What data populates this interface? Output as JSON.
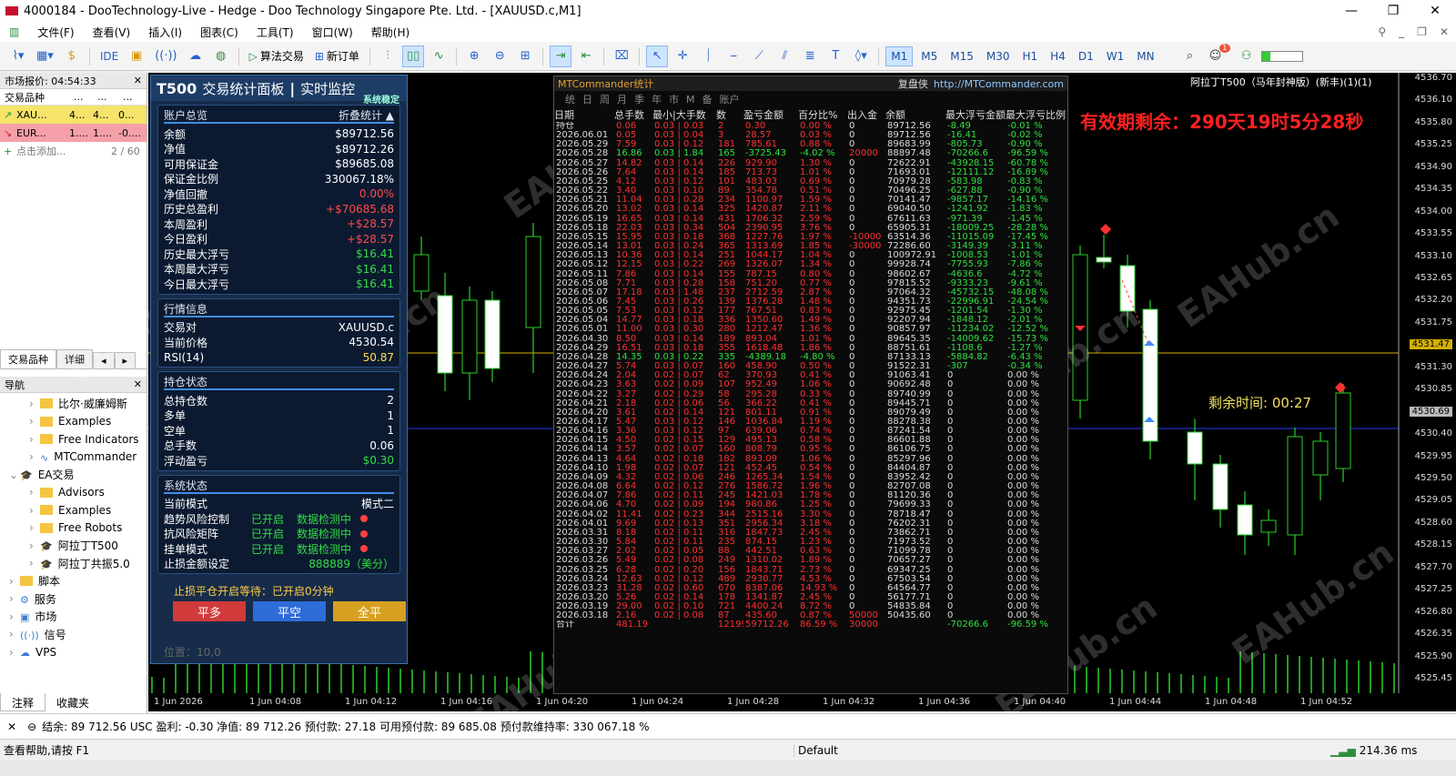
{
  "window": {
    "title": "4000184 - DooTechnology-Live - Hedge - Doo Technology Singapore Pte. Ltd. - [XAUUSD.c,M1]"
  },
  "menu": [
    "文件(F)",
    "查看(V)",
    "插入(I)",
    "图表(C)",
    "工具(T)",
    "窗口(W)",
    "帮助(H)"
  ],
  "toolbar": {
    "ide": "IDE",
    "algo": "算法交易",
    "new_order": "新订单",
    "timeframes": [
      "M1",
      "M5",
      "M15",
      "M30",
      "H1",
      "H4",
      "D1",
      "W1",
      "MN"
    ],
    "active_tf": "M1",
    "notif": "1"
  },
  "market_watch": {
    "title": "市场报价: 04:54:33",
    "col_symbol": "交易品种",
    "col_bid": "...",
    "col_ask": "...",
    "col_chg": "...",
    "rows": [
      {
        "symbol": "XAU...",
        "bid": "4...",
        "ask": "4...",
        "chg": "0...",
        "color": "#f5e36a"
      },
      {
        "symbol": "EUR...",
        "bid": "1....",
        "ask": "1....",
        "chg": "-0....",
        "color": "#f5a0a8"
      }
    ],
    "add": "点击添加...",
    "count": "2 / 60",
    "tab_symbols": "交易品种",
    "tab_details": "详细"
  },
  "navigator": {
    "title": "导航",
    "items": [
      {
        "label": "比尔·威廉姆斯",
        "indent": 2,
        "icon": "folder"
      },
      {
        "label": "Examples",
        "indent": 2,
        "icon": "folder"
      },
      {
        "label": "Free Indicators",
        "indent": 2,
        "icon": "folder"
      },
      {
        "label": "MTCommander",
        "indent": 2,
        "icon": "indicator"
      },
      {
        "label": "EA交易",
        "indent": 1,
        "icon": "ea"
      },
      {
        "label": "Advisors",
        "indent": 2,
        "icon": "folder"
      },
      {
        "label": "Examples",
        "indent": 2,
        "icon": "folder"
      },
      {
        "label": "Free Robots",
        "indent": 2,
        "icon": "folder"
      },
      {
        "label": "阿拉丁T500",
        "indent": 2,
        "icon": "ea"
      },
      {
        "label": "阿拉丁共振5.0",
        "indent": 2,
        "icon": "ea"
      },
      {
        "label": "脚本",
        "indent": 1,
        "icon": "folder"
      },
      {
        "label": "服务",
        "indent": 1,
        "icon": "gear"
      },
      {
        "label": "市场",
        "indent": 1,
        "icon": "bag"
      },
      {
        "label": "信号",
        "indent": 1,
        "icon": "signal"
      },
      {
        "label": "VPS",
        "indent": 1,
        "icon": "cloud"
      }
    ],
    "tab_comments": "注释",
    "tab_favorites": "收藏夹"
  },
  "panel": {
    "brand": "T500",
    "title": "交易统计面板",
    "sep": "|",
    "title2": "实时监控",
    "status": "系统稳定",
    "account": {
      "title": "账户总览",
      "toggle": "折叠统计 ▲",
      "rows": [
        {
          "k": "余额",
          "v": "$89712.56",
          "c": "white"
        },
        {
          "k": "净值",
          "v": "$89712.26",
          "c": "white"
        },
        {
          "k": "可用保证金",
          "v": "$89685.08",
          "c": "white"
        },
        {
          "k": "保证金比例",
          "v": "330067.18%",
          "c": "white"
        },
        {
          "k": "净值回撤",
          "v": "0.00%",
          "c": "red"
        },
        {
          "k": "历史总盈利",
          "v": "+$70685.68",
          "c": "red"
        },
        {
          "k": "本周盈利",
          "v": "+$28.57",
          "c": "red"
        },
        {
          "k": "今日盈利",
          "v": "+$28.57",
          "c": "red"
        },
        {
          "k": "历史最大浮亏",
          "v": "$16.41",
          "c": "green"
        },
        {
          "k": "本周最大浮亏",
          "v": "$16.41",
          "c": "green"
        },
        {
          "k": "今日最大浮亏",
          "v": "$16.41",
          "c": "green"
        }
      ]
    },
    "market": {
      "title": "行情信息",
      "rows": [
        {
          "k": "交易对",
          "v": "XAUUSD.c",
          "c": "white"
        },
        {
          "k": "当前价格",
          "v": "4530.54",
          "c": "white"
        },
        {
          "k": "RSI(14)",
          "v": "50.87",
          "c": "yellow"
        }
      ]
    },
    "position": {
      "title": "持仓状态",
      "rows": [
        {
          "k": "总持仓数",
          "v": "2",
          "c": "white"
        },
        {
          "k": "多单",
          "v": "1",
          "c": "white"
        },
        {
          "k": "空单",
          "v": "1",
          "c": "white"
        },
        {
          "k": "总手数",
          "v": "0.06",
          "c": "white"
        },
        {
          "k": "浮动盈亏",
          "v": "$0.30",
          "c": "green"
        }
      ]
    },
    "system": {
      "title": "系统状态",
      "mode_k": "当前模式",
      "mode_v": "模式二",
      "rows": [
        {
          "k": "趋势风险控制",
          "s": "已开启",
          "d": "数据检测中"
        },
        {
          "k": "抗风险矩阵",
          "s": "已开启",
          "d": "数据检测中"
        },
        {
          "k": "挂单模式",
          "s": "已开启",
          "d": "数据检测中"
        }
      ],
      "sl_k": "止损金额设定",
      "sl_v": "888889（美分）"
    },
    "wait": "止损平仓开启等待：已开启0分钟",
    "btn_close_long": "平多",
    "btn_close_short": "平空",
    "btn_close_all": "全平",
    "pos": "位置：10,0"
  },
  "stats": {
    "title": "MTCommander统计",
    "replay": "复盘侠",
    "url": "http://MTCommander.com",
    "tabs": [
      "统",
      "日",
      "周",
      "月",
      "季",
      "年",
      "市",
      "M",
      "备",
      "账户"
    ],
    "headers": [
      "日期",
      "总手数",
      "最小|大手数",
      "数",
      "盈亏金额",
      "百分比%",
      "出入金",
      "余额",
      "最大浮亏金额",
      "最大浮亏比例"
    ],
    "rows": [
      [
        "持仓",
        "0.06",
        "0.03 | 0.03",
        "2",
        "0.30",
        "0.00 %",
        "0",
        "89712.56",
        "-8.49",
        "-0.01 %"
      ],
      [
        "2026.06.01",
        "0.05",
        "0.03 | 0.04",
        "3",
        "28.57",
        "0.03 %",
        "0",
        "89712.56",
        "-16.41",
        "-0.02 %"
      ],
      [
        "2026.05.29",
        "7.59",
        "0.03 | 0.12",
        "181",
        "785.61",
        "0.88 %",
        "0",
        "89683.99",
        "-805.73",
        "-0.90 %"
      ],
      [
        "2026.05.28",
        "16.86",
        "0.03 | 1.84",
        "165",
        "-3725.43",
        "-4.02 %",
        "20000",
        "88897.48",
        "-70266.6",
        "-96.59 %"
      ],
      [
        "2026.05.27",
        "14.82",
        "0.03 | 0.14",
        "226",
        "929.90",
        "1.30 %",
        "0",
        "72622.91",
        "-43928.15",
        "-60.78 %"
      ],
      [
        "2026.05.26",
        "7.64",
        "0.03 | 0.14",
        "185",
        "713.73",
        "1.01 %",
        "0",
        "71693.01",
        "-12111.12",
        "-16.89 %"
      ],
      [
        "2026.05.25",
        "4.12",
        "0.03 | 0.12",
        "101",
        "483.03",
        "0.69 %",
        "0",
        "70979.28",
        "-583.98",
        "-0.83 %"
      ],
      [
        "2026.05.22",
        "3.40",
        "0.03 | 0.10",
        "89",
        "354.78",
        "0.51 %",
        "0",
        "70496.25",
        "-627.88",
        "-0.90 %"
      ],
      [
        "2026.05.21",
        "11.04",
        "0.03 | 0.28",
        "234",
        "1100.97",
        "1.59 %",
        "0",
        "70141.47",
        "-9857.17",
        "-14.16 %"
      ],
      [
        "2026.05.20",
        "13.02",
        "0.03 | 0.14",
        "325",
        "1420.87",
        "2.11 %",
        "0",
        "69040.50",
        "-1241.92",
        "-1.83 %"
      ],
      [
        "2026.05.19",
        "16.65",
        "0.03 | 0.14",
        "431",
        "1706.32",
        "2.59 %",
        "0",
        "67611.63",
        "-971.39",
        "-1.45 %"
      ],
      [
        "2026.05.18",
        "22.03",
        "0.03 | 0.34",
        "504",
        "2390.95",
        "3.76 %",
        "0",
        "65905.31",
        "-18009.25",
        "-28.28 %"
      ],
      [
        "2026.05.15",
        "15.95",
        "0.03 | 0.18",
        "368",
        "1227.76",
        "1.97 %",
        "-10000",
        "63514.36",
        "-11015.09",
        "-17.45 %"
      ],
      [
        "2026.05.14",
        "13.01",
        "0.03 | 0.24",
        "365",
        "1313.69",
        "1.85 %",
        "-30000",
        "72286.60",
        "-3149.39",
        "-3.11 %"
      ],
      [
        "2026.05.13",
        "10.36",
        "0.03 | 0.14",
        "251",
        "1044.17",
        "1.04 %",
        "0",
        "100972.91",
        "-1008.53",
        "-1.01 %"
      ],
      [
        "2026.05.12",
        "12.15",
        "0.03 | 0.22",
        "269",
        "1326.07",
        "1.34 %",
        "0",
        "99928.74",
        "-7755.93",
        "-7.86 %"
      ],
      [
        "2026.05.11",
        "7.86",
        "0.03 | 0.14",
        "155",
        "787.15",
        "0.80 %",
        "0",
        "98602.67",
        "-4636.6",
        "-4.72 %"
      ],
      [
        "2026.05.08",
        "7.71",
        "0.03 | 0.28",
        "158",
        "751.20",
        "0.77 %",
        "0",
        "97815.52",
        "-9333.23",
        "-9.61 %"
      ],
      [
        "2026.05.07",
        "17.18",
        "0.03 | 1.48",
        "237",
        "2712.59",
        "2.87 %",
        "0",
        "97064.32",
        "-45732.15",
        "-48.08 %"
      ],
      [
        "2026.05.06",
        "7.45",
        "0.03 | 0.26",
        "139",
        "1376.28",
        "1.48 %",
        "0",
        "94351.73",
        "-22996.91",
        "-24.54 %"
      ],
      [
        "2026.05.05",
        "7.53",
        "0.03 | 0.12",
        "177",
        "767.51",
        "0.83 %",
        "0",
        "92975.45",
        "-1201.54",
        "-1.30 %"
      ],
      [
        "2026.05.04",
        "14.77",
        "0.03 | 0.18",
        "336",
        "1350.60",
        "1.49 %",
        "0",
        "92207.94",
        "-1848.12",
        "-2.01 %"
      ],
      [
        "2026.05.01",
        "11.00",
        "0.03 | 0.30",
        "280",
        "1212.47",
        "1.36 %",
        "0",
        "90857.97",
        "-11234.02",
        "-12.52 %"
      ],
      [
        "2026.04.30",
        "8.50",
        "0.03 | 0.14",
        "189",
        "893.04",
        "1.01 %",
        "0",
        "89645.35",
        "-14009.62",
        "-15.73 %"
      ],
      [
        "2026.04.29",
        "16.51",
        "0.03 | 0.18",
        "355",
        "1618.48",
        "1.86 %",
        "0",
        "88751.61",
        "-1108.6",
        "-1.27 %"
      ],
      [
        "2026.04.28",
        "14.35",
        "0.03 | 0.22",
        "335",
        "-4389.18",
        "-4.80 %",
        "0",
        "87133.13",
        "-5884.82",
        "-6.43 %"
      ],
      [
        "2026.04.27",
        "5.74",
        "0.03 | 0.07",
        "160",
        "458.90",
        "0.50 %",
        "0",
        "91522.31",
        "-307",
        "-0.34 %"
      ],
      [
        "2026.04.24",
        "2.04",
        "0.02 | 0.07",
        "62",
        "370.93",
        "0.41 %",
        "0",
        "91063.41",
        "0",
        "0.00 %"
      ],
      [
        "2026.04.23",
        "3.63",
        "0.02 | 0.09",
        "107",
        "952.49",
        "1.06 %",
        "0",
        "90692.48",
        "0",
        "0.00 %"
      ],
      [
        "2026.04.22",
        "3.27",
        "0.02 | 0.29",
        "58",
        "295.28",
        "0.33 %",
        "0",
        "89740.99",
        "0",
        "0.00 %"
      ],
      [
        "2026.04.21",
        "2.18",
        "0.02 | 0.06",
        "56",
        "366.22",
        "0.41 %",
        "0",
        "89445.71",
        "0",
        "0.00 %"
      ],
      [
        "2026.04.20",
        "3.61",
        "0.02 | 0.14",
        "121",
        "801.11",
        "0.91 %",
        "0",
        "89079.49",
        "0",
        "0.00 %"
      ],
      [
        "2026.04.17",
        "5.47",
        "0.03 | 0.12",
        "146",
        "1036.84",
        "1.19 %",
        "0",
        "88278.38",
        "0",
        "0.00 %"
      ],
      [
        "2026.04.16",
        "3.36",
        "0.03 | 0.12",
        "97",
        "639.06",
        "0.74 %",
        "0",
        "87241.54",
        "0",
        "0.00 %"
      ],
      [
        "2026.04.15",
        "4.50",
        "0.02 | 0.15",
        "129",
        "495.13",
        "0.58 %",
        "0",
        "86601.88",
        "0",
        "0.00 %"
      ],
      [
        "2026.04.14",
        "3.57",
        "0.02 | 0.07",
        "160",
        "808.79",
        "0.95 %",
        "0",
        "86106.75",
        "0",
        "0.00 %"
      ],
      [
        "2026.04.13",
        "4.64",
        "0.02 | 0.18",
        "182",
        "893.09",
        "1.06 %",
        "0",
        "85297.96",
        "0",
        "0.00 %"
      ],
      [
        "2026.04.10",
        "1.98",
        "0.02 | 0.07",
        "121",
        "452.45",
        "0.54 %",
        "0",
        "84404.87",
        "0",
        "0.00 %"
      ],
      [
        "2026.04.09",
        "4.32",
        "0.02 | 0.06",
        "246",
        "1265.34",
        "1.54 %",
        "0",
        "83952.42",
        "0",
        "0.00 %"
      ],
      [
        "2026.04.08",
        "6.64",
        "0.02 | 0.12",
        "276",
        "1586.72",
        "1.96 %",
        "0",
        "82707.08",
        "0",
        "0.00 %"
      ],
      [
        "2026.04.07",
        "7.86",
        "0.02 | 0.11",
        "245",
        "1421.03",
        "1.78 %",
        "0",
        "81120.36",
        "0",
        "0.00 %"
      ],
      [
        "2026.04.06",
        "4.70",
        "0.02 | 0.09",
        "194",
        "980.86",
        "1.25 %",
        "0",
        "79699.33",
        "0",
        "0.00 %"
      ],
      [
        "2026.04.02",
        "11.41",
        "0.02 | 0.23",
        "344",
        "2515.16",
        "3.30 %",
        "0",
        "78718.47",
        "0",
        "0.00 %"
      ],
      [
        "2026.04.01",
        "9.69",
        "0.02 | 0.13",
        "351",
        "2956.34",
        "3.18 %",
        "0",
        "76202.31",
        "0",
        "0.00 %"
      ],
      [
        "2026.03.31",
        "8.18",
        "0.02 | 0.11",
        "316",
        "1847.73",
        "2.45 %",
        "0",
        "73862.71",
        "0",
        "0.00 %"
      ],
      [
        "2026.03.30",
        "5.84",
        "0.02 | 0.11",
        "235",
        "874.15",
        "1.23 %",
        "0",
        "71973.52",
        "0",
        "0.00 %"
      ],
      [
        "2026.03.27",
        "2.02",
        "0.02 | 0.05",
        "88",
        "442.51",
        "0.63 %",
        "0",
        "71099.78",
        "0",
        "0.00 %"
      ],
      [
        "2026.03.26",
        "5.49",
        "0.02 | 0.08",
        "249",
        "1310.02",
        "1.89 %",
        "0",
        "70657.27",
        "0",
        "0.00 %"
      ],
      [
        "2026.03.25",
        "6.28",
        "0.02 | 0.20",
        "156",
        "1843.71",
        "2.73 %",
        "0",
        "69347.25",
        "0",
        "0.00 %"
      ],
      [
        "2026.03.24",
        "12.63",
        "0.02 | 0.12",
        "489",
        "2930.77",
        "4.53 %",
        "0",
        "67503.54",
        "0",
        "0.00 %"
      ],
      [
        "2026.03.23",
        "31.28",
        "0.02 | 0.60",
        "670",
        "8387.06",
        "14.93 %",
        "0",
        "64564.77",
        "0",
        "0.00 %"
      ],
      [
        "2026.03.20",
        "5.26",
        "0.02 | 0.14",
        "178",
        "1341.87",
        "2.45 %",
        "0",
        "56177.71",
        "0",
        "0.00 %"
      ],
      [
        "2026.03.19",
        "29.00",
        "0.02 | 0.10",
        "721",
        "4400.24",
        "8.72 %",
        "0",
        "54835.84",
        "0",
        "0.00 %"
      ],
      [
        "2026.03.18",
        "2.16",
        "0.02 | 0.08",
        "87",
        "435.60",
        "0.87 %",
        "50000",
        "50435.60",
        "0",
        "0.00 %"
      ],
      [
        "合计",
        "481.19",
        "",
        "12199",
        "59712.26",
        "86.59 %",
        "30000",
        "",
        "-70266.6",
        "-96.59 %"
      ]
    ]
  },
  "chart": {
    "ea_label": "阿拉丁T500（马年封神版）(新丰)(1)(1)",
    "expiry": "有效期剩余：290天19时5分28秒",
    "remaining": "剩余时间: 00:27",
    "price_labels": [
      "4536.70",
      "4536.10",
      "4535.80",
      "4535.25",
      "4534.90",
      "4534.35",
      "4534.00",
      "4533.55",
      "4533.10",
      "4532.65",
      "4532.20",
      "4531.75",
      "4531.47",
      "4531.30",
      "4530.85",
      "4530.69",
      "4530.40",
      "4529.95",
      "4529.50",
      "4529.05",
      "4528.60",
      "4528.15",
      "4527.70",
      "4527.25",
      "4526.80",
      "4526.35",
      "4525.90",
      "4525.45"
    ],
    "time_labels": [
      "1 Jun 2026",
      "1 Jun 04:08",
      "1 Jun 04:12",
      "1 Jun 04:16",
      "1 Jun 04:20",
      "1 Jun 04:24",
      "1 Jun 04:28",
      "1 Jun 04:32",
      "1 Jun 04:36",
      "1 Jun 04:40",
      "1 Jun 04:44",
      "1 Jun 04:48",
      "1 Jun 04:52"
    ],
    "watermark": "EAHub.cn"
  },
  "status": {
    "line": "结余: 89 712.56 USC  盈利: -0.30  净值: 89 712.26  预付款: 27.18  可用预付款: 89 685.08  预付款维持率: 330 067.18 %",
    "help": "查看帮助,请按 F1",
    "profile": "Default",
    "ping": "214.36 ms"
  }
}
